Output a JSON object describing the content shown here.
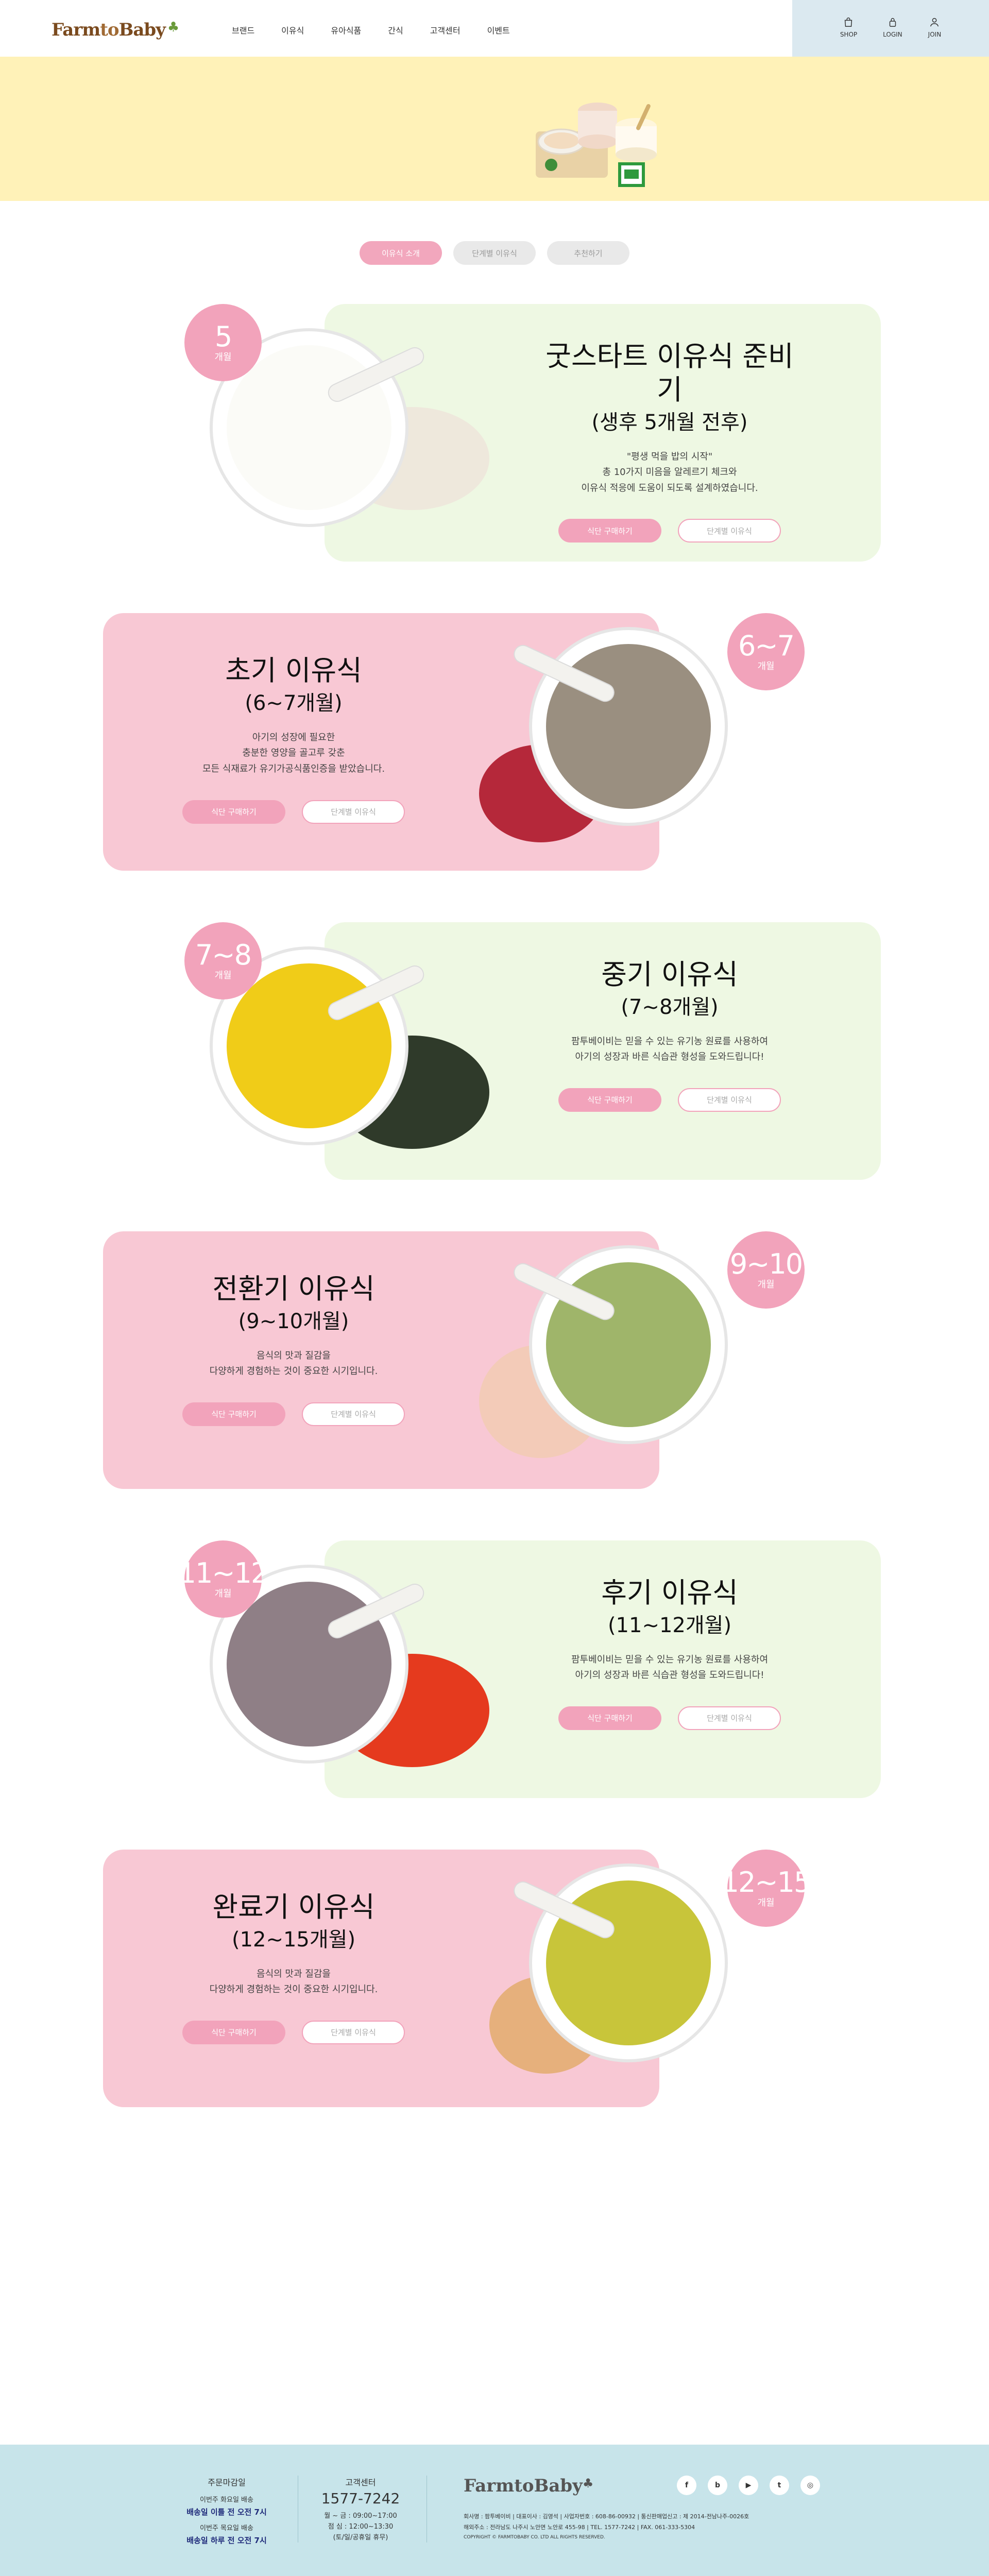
{
  "header": {
    "logo": {
      "farm": "Farm",
      "to": "to",
      "baby": "Baby"
    },
    "nav": [
      "브랜드",
      "이유식",
      "유아식품",
      "간식",
      "고객센터",
      "이벤트"
    ],
    "util": [
      {
        "label": "SHOP",
        "icon": "shopping-bag-icon"
      },
      {
        "label": "LOGIN",
        "icon": "lock-icon"
      },
      {
        "label": "JOIN",
        "icon": "user-plus-icon"
      }
    ]
  },
  "tabs": [
    {
      "label": "이유식 소개",
      "active": true
    },
    {
      "label": "단계별 이유식",
      "active": false
    },
    {
      "label": "추천하기",
      "active": false
    }
  ],
  "stages": [
    {
      "badge_num": "5",
      "badge_unit": "개월",
      "title": "굿스타트 이유식 준비기",
      "subtitle": "(생후 5개월 전후)",
      "desc": "\"평생 먹을 밥의 시작\"\n총 10가지 미음을 알레르기 체크와\n이유식 적응에 도움이 되도록 설계하였습니다.",
      "btn_primary": "식단 구매하기",
      "btn_ghost": "단계별 이유식",
      "food_color": "#fbfbf7",
      "side_color": "#eee8dc"
    },
    {
      "badge_num": "6~7",
      "badge_unit": "개월",
      "title": "초기 이유식",
      "subtitle": "(6~7개월)",
      "desc": "아기의 성장에 필요한\n충분한 영양을 골고루 갖춘\n모든 식재료가 유기가공식품인증을 받았습니다.",
      "btn_primary": "식단 구매하기",
      "btn_ghost": "단계별 이유식",
      "food_color": "#9a8f80",
      "side_color": "#b5283a"
    },
    {
      "badge_num": "7~8",
      "badge_unit": "개월",
      "title": "중기 이유식",
      "subtitle": "(7~8개월)",
      "desc": "팜투베이비는 믿을 수 있는 유기농 원료를 사용하여\n아기의 성장과 바른 식습관 형성을 도와드립니다!",
      "btn_primary": "식단 구매하기",
      "btn_ghost": "단계별 이유식",
      "food_color": "#f0cc18",
      "side_color": "#2f3a2a"
    },
    {
      "badge_num": "9~10",
      "badge_unit": "개월",
      "title": "전환기 이유식",
      "subtitle": "(9~10개월)",
      "desc": "음식의 맛과 질감을\n다양하게 경험하는 것이 중요한 시기입니다.",
      "btn_primary": "식단 구매하기",
      "btn_ghost": "단계별 이유식",
      "food_color": "#9fb56a",
      "side_color": "#f3cbb8"
    },
    {
      "badge_num": "11~12",
      "badge_unit": "개월",
      "title": "후기 이유식",
      "subtitle": "(11~12개월)",
      "desc": "팜투베이비는 믿을 수 있는 유기농 원료를 사용하여\n아기의 성장과 바른 식습관 형성을 도와드립니다!",
      "btn_primary": "식단 구매하기",
      "btn_ghost": "단계별 이유식",
      "food_color": "#8f7f86",
      "side_color": "#e53a1e"
    },
    {
      "badge_num": "12~15",
      "badge_unit": "개월",
      "title": "완료기 이유식",
      "subtitle": "(12~15개월)",
      "desc": "음식의 맛과 질감을\n다양하게 경험하는 것이 중요한 시기입니다.",
      "btn_primary": "식단 구매하기",
      "btn_ghost": "단계별 이유식",
      "food_color": "#c8c53a",
      "side_color": "#e6b07c"
    }
  ],
  "footer": {
    "order": {
      "title": "주문마감일",
      "line1": "이번주 화요일 배송",
      "strong1": "배송일 이틀 전 오전 7시",
      "line2": "이번주 목요일 배송",
      "strong2": "배송일 하루 전 오전 7시"
    },
    "cs": {
      "title": "고객센터",
      "phone": "1577-7242",
      "hours1": "월 ~ 금 : 09:00~17:00",
      "hours2": "점 심 : 12:00~13:30",
      "hours3": "(토/일/공휴일 휴무)"
    },
    "logo": {
      "farm": "Farm",
      "to": "to",
      "baby": "Baby"
    },
    "info1": "회사명 : 팜투베이비 | 대표이사 : 김영석 | 사업자번호 : 608-86-00932 | 통신판매업신고 : 제 2014-전남나주-0026호",
    "info2": "해외주소 : 전라남도 나주시 노안면 노안로 455-98 | TEL. 1577-7242 | FAX. 061-333-5304",
    "copyright": "COPYRIGHT © FARMTOBABY CO. LTD ALL RIGHTS RESERVED.",
    "sns": [
      {
        "label": "f",
        "icon": "facebook-icon"
      },
      {
        "label": "b",
        "icon": "blog-icon"
      },
      {
        "label": "▶",
        "icon": "youtube-icon"
      },
      {
        "label": "t",
        "icon": "twitter-icon"
      },
      {
        "label": "◎",
        "icon": "instagram-icon"
      }
    ]
  }
}
